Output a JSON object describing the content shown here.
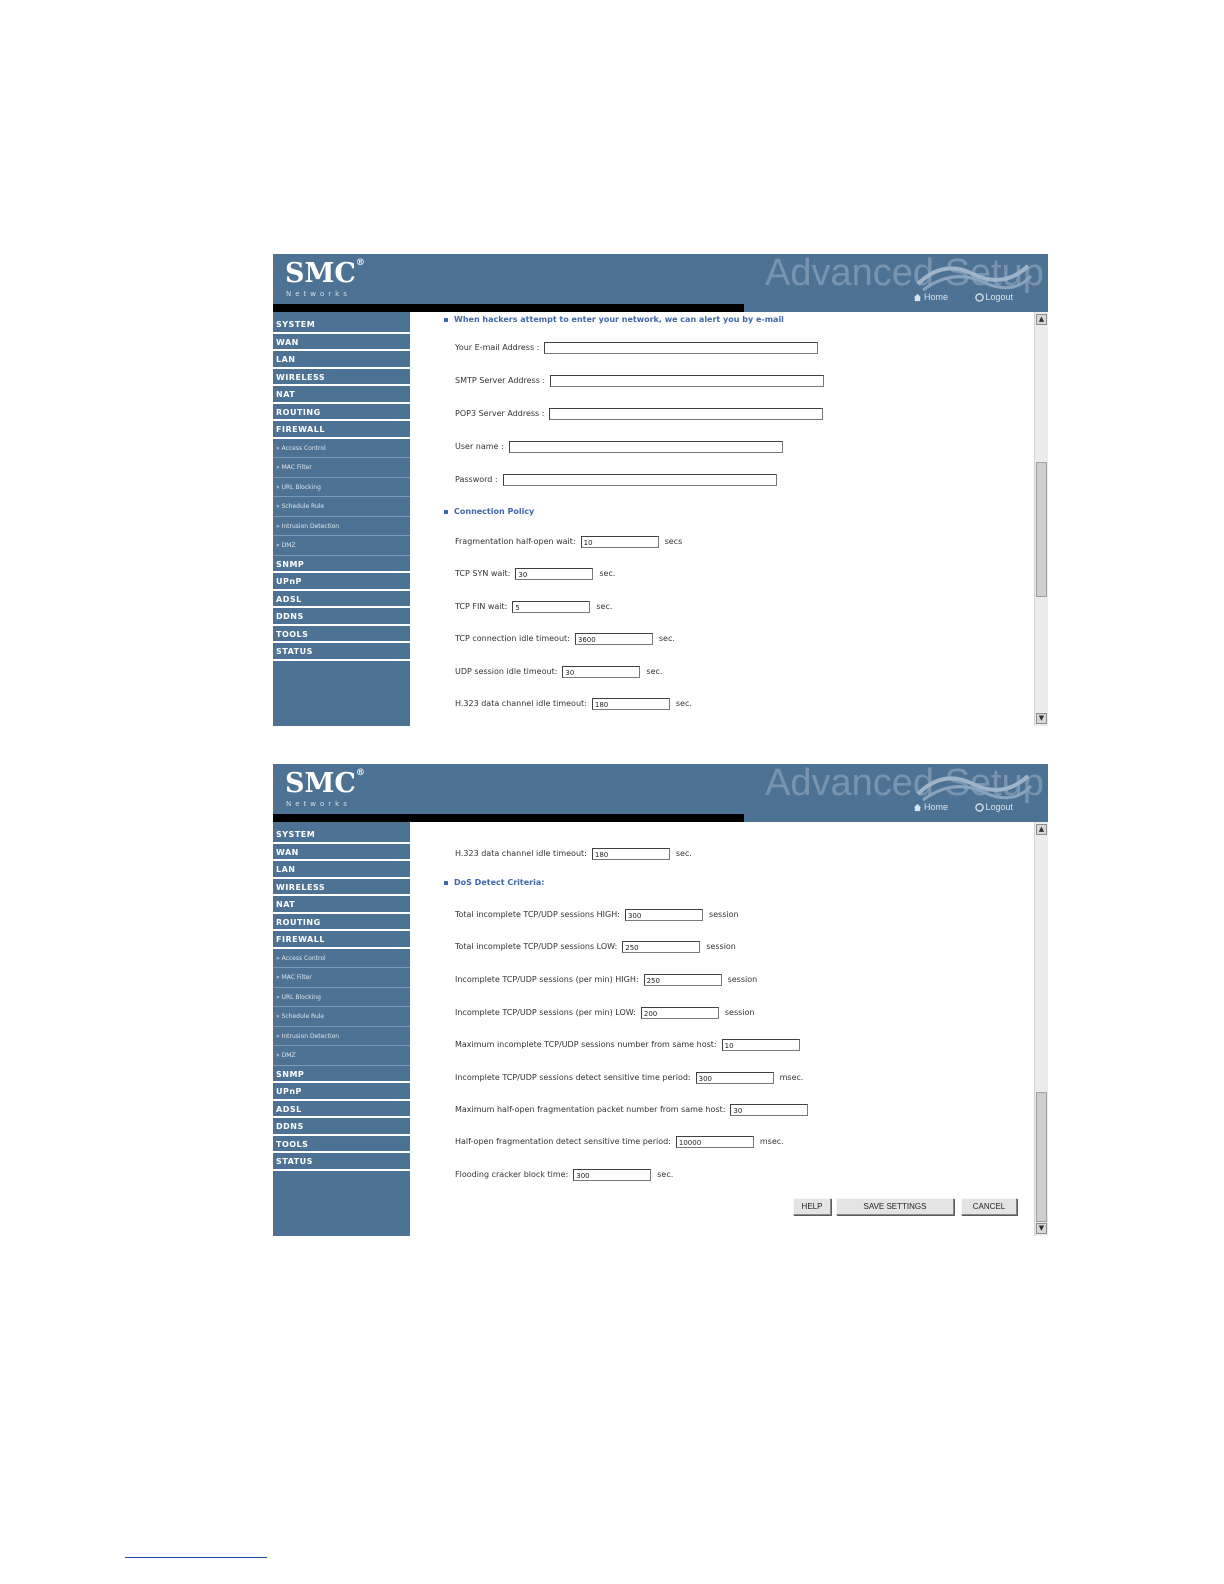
{
  "header": {
    "logo": "SMC",
    "registered": "®",
    "tagline": "Networks",
    "brand_title": "Advanced Setup",
    "home_link": "Home",
    "logout_link": "Logout"
  },
  "sidebar": {
    "items": [
      {
        "label": "SYSTEM",
        "type": "main"
      },
      {
        "label": "WAN",
        "type": "main"
      },
      {
        "label": "LAN",
        "type": "main"
      },
      {
        "label": "WIRELESS",
        "type": "main"
      },
      {
        "label": "NAT",
        "type": "main"
      },
      {
        "label": "ROUTING",
        "type": "main"
      },
      {
        "label": "FIREWALL",
        "type": "main"
      },
      {
        "label": "» Access Control",
        "type": "sub"
      },
      {
        "label": "» MAC Filter",
        "type": "sub"
      },
      {
        "label": "» URL Blocking",
        "type": "sub"
      },
      {
        "label": "» Schedule Rule",
        "type": "sub"
      },
      {
        "label": "» Intrusion Detection",
        "type": "sub"
      },
      {
        "label": "» DMZ",
        "type": "sub"
      },
      {
        "label": "SNMP",
        "type": "main"
      },
      {
        "label": "UPnP",
        "type": "main"
      },
      {
        "label": "ADSL",
        "type": "main"
      },
      {
        "label": "DDNS",
        "type": "main"
      },
      {
        "label": "TOOLS",
        "type": "main"
      },
      {
        "label": "STATUS",
        "type": "main"
      }
    ]
  },
  "screen1": {
    "email_section_title": "When hackers attempt to enter your network, we can alert you by e-mail",
    "email_fields": [
      {
        "label": "Your E-mail Address :",
        "value": ""
      },
      {
        "label": "SMTP Server Address :",
        "value": ""
      },
      {
        "label": "POP3 Server Address :",
        "value": ""
      },
      {
        "label": "User name :",
        "value": ""
      },
      {
        "label": "Password :",
        "value": ""
      }
    ],
    "policy_section_title": "Connection Policy",
    "policy_fields": [
      {
        "label": "Fragmentation half-open wait:",
        "value": "10",
        "unit": "secs"
      },
      {
        "label": "TCP SYN wait:",
        "value": "30",
        "unit": "sec."
      },
      {
        "label": "TCP FIN wait:",
        "value": "5",
        "unit": "sec."
      },
      {
        "label": "TCP connection idle timeout:",
        "value": "3600",
        "unit": "sec."
      },
      {
        "label": "UDP session idle timeout:",
        "value": "30",
        "unit": "sec."
      },
      {
        "label": "H.323 data channel idle timeout:",
        "value": "180",
        "unit": "sec."
      }
    ]
  },
  "screen2": {
    "top_field": {
      "label": "H.323 data channel idle timeout:",
      "value": "180",
      "unit": "sec."
    },
    "dos_section_title": "DoS Detect Criteria:",
    "dos_fields": [
      {
        "label": "Total incomplete TCP/UDP sessions HIGH:",
        "value": "300",
        "unit": "session"
      },
      {
        "label": "Total incomplete TCP/UDP sessions LOW:",
        "value": "250",
        "unit": "session"
      },
      {
        "label": "Incomplete TCP/UDP sessions (per min) HIGH:",
        "value": "250",
        "unit": "session"
      },
      {
        "label": "Incomplete TCP/UDP sessions (per min) LOW:",
        "value": "200",
        "unit": "session"
      },
      {
        "label": "Maximum incomplete TCP/UDP sessions number from same host:",
        "value": "10",
        "unit": ""
      },
      {
        "label": "Incomplete TCP/UDP sessions detect sensitive time period:",
        "value": "300",
        "unit": "msec."
      },
      {
        "label": "Maximum half-open fragmentation packet number from same host:",
        "value": "30",
        "unit": ""
      },
      {
        "label": "Half-open fragmentation detect sensitive time period:",
        "value": "10000",
        "unit": "msec."
      },
      {
        "label": "Flooding cracker block time:",
        "value": "300",
        "unit": "sec."
      }
    ],
    "buttons": {
      "help": "HELP",
      "save": "SAVE SETTINGS",
      "cancel": "CANCEL"
    }
  },
  "scrollbar": {
    "up_arrow": "▲",
    "down_arrow": "▼"
  },
  "colors": {
    "nav_blue": "#4e7294",
    "section_blue": "#3e68a8"
  }
}
